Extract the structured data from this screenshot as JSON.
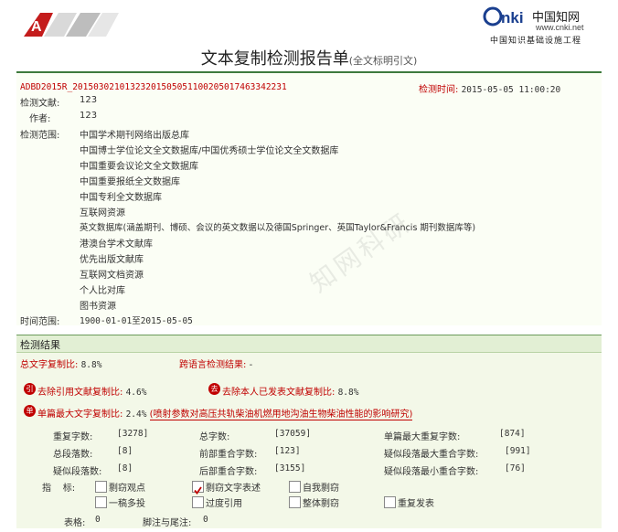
{
  "header": {
    "logo_left_icon": "amm-logo",
    "cnki_logo_text": "CNKI中国知网",
    "cnki_url": "www.cnki.net",
    "cnki_subtitle": "中国知识基础设施工程",
    "title": "文本复制检测报告单",
    "title_sub": "(全文标明引文)"
  },
  "meta": {
    "doc_id": "ADBD2015R_20150302101323201505051100205017463342231",
    "check_time_label": "检测时间:",
    "check_time": "2015-05-05 11:00:20",
    "doc_label": "检测文献:",
    "doc_value": "123",
    "author_label": "作者:",
    "author_value": "123",
    "scope_label": "检测范围:",
    "scope": [
      "中国学术期刊网络出版总库",
      "中国博士学位论文全文数据库/中国优秀硕士学位论文全文数据库",
      "中国重要会议论文全文数据库",
      "中国重要报纸全文数据库",
      "中国专利全文数据库",
      "互联网资源",
      "英文数据库(涵盖期刊、博硕、会议的英文数据以及德国Springer、英国Taylor&Francis 期刊数据库等)",
      "港澳台学术文献库",
      "优先出版文献库",
      "互联网文档资源",
      "个人比对库",
      "图书资源"
    ],
    "time_range_label": "时间范围:",
    "time_range": "1900-01-01至2015-05-05"
  },
  "result": {
    "head": "检测结果",
    "total_label": "总文字复制比:",
    "total_value": "8.8%",
    "cross_label": "跨语言检测结果:",
    "cross_value": "-",
    "excl_ref_label": "去除引用文献复制比:",
    "excl_ref_value": "4.6%",
    "excl_self_label": "去除本人已发表文献复制比:",
    "excl_self_value": "8.8%",
    "single_max_label": "单篇最大文字复制比:",
    "single_max_value": "2.4%",
    "single_max_title": "(喷射参数对高压共轨柴油机燃用地沟油生物柴油性能的影响研究)",
    "icon_ref": "引",
    "icon_self": "去",
    "icon_single": "单",
    "stats": [
      {
        "label": "重复字数:",
        "value": "[3278]"
      },
      {
        "label": "总字数:",
        "value": "[37059]"
      },
      {
        "label": "单篇最大重复字数:",
        "value": "[874]"
      },
      {
        "label": "总段落数:",
        "value": "[8]"
      },
      {
        "label": "前部重合字数:",
        "value": "[123]"
      },
      {
        "label": "疑似段落最大重合字数:",
        "value": "[991]"
      },
      {
        "label": "疑似段落数:",
        "value": "[8]"
      },
      {
        "label": "后部重合字数:",
        "value": "[3155]"
      },
      {
        "label": "疑似段落最小重合字数:",
        "value": "[76]"
      }
    ],
    "indicator_label": "指    标:",
    "indicators": [
      {
        "label": "剽窃观点",
        "checked": false
      },
      {
        "label": "剽窃文字表述",
        "checked": true
      },
      {
        "label": "自我剽窃",
        "checked": false
      },
      {
        "label": "一稿多投",
        "checked": false
      },
      {
        "label": "过度引用",
        "checked": false
      },
      {
        "label": "整体剽窃",
        "checked": false
      },
      {
        "label": "重复发表",
        "checked": false
      }
    ],
    "tables_label": "表格:",
    "tables_value": "0",
    "footnotes_label": "脚注与尾注:",
    "footnotes_value": "0"
  },
  "watermark": "知网科研"
}
